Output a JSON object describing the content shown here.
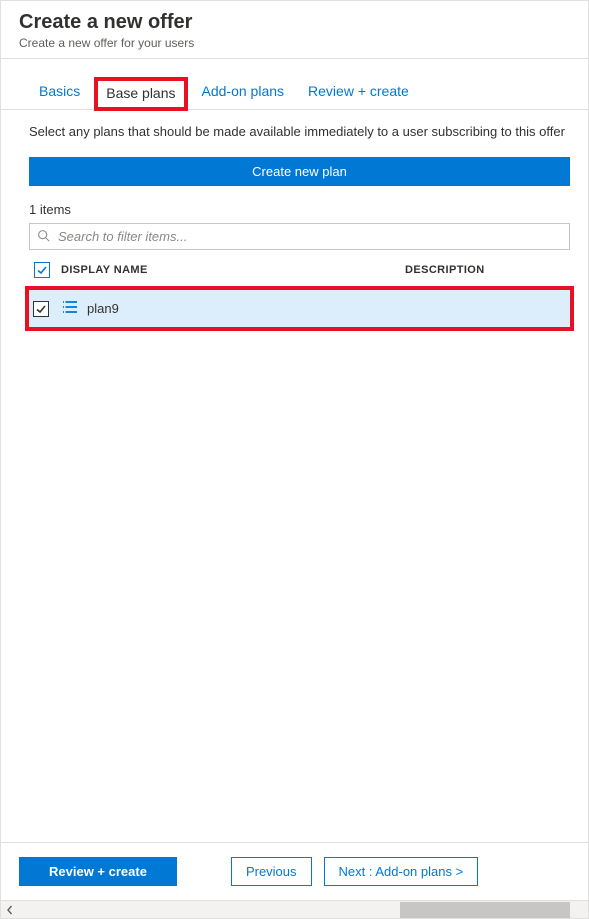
{
  "header": {
    "title": "Create a new offer",
    "subtitle": "Create a new offer for your users"
  },
  "tabs": {
    "basics": "Basics",
    "base_plans": "Base plans",
    "addon_plans": "Add-on plans",
    "review_create": "Review + create"
  },
  "content": {
    "description": "Select any plans that should be made available immediately to a user subscribing to this offer",
    "create_plan_label": "Create new plan",
    "items_count": "1 items",
    "filter_placeholder": "Search to filter items..."
  },
  "table": {
    "columns": {
      "display_name": "DISPLAY NAME",
      "description": "DESCRIPTION"
    },
    "rows": [
      {
        "name": "plan9",
        "checked": true
      }
    ]
  },
  "footer": {
    "review_create": "Review + create",
    "previous": "Previous",
    "next": "Next : Add-on plans >"
  }
}
